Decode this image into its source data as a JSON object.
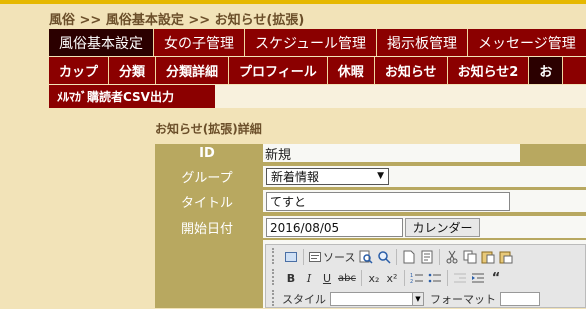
{
  "breadcrumb": "風俗 >> 風俗基本設定 >> お知らせ(拡張)",
  "nav_primary": [
    {
      "label": "風俗基本設定",
      "active": true
    },
    {
      "label": "女の子管理"
    },
    {
      "label": "スケジュール管理"
    },
    {
      "label": "掲示板管理"
    },
    {
      "label": "メッセージ管理"
    }
  ],
  "nav_secondary": [
    {
      "label": "カップ"
    },
    {
      "label": "分類"
    },
    {
      "label": "分類詳細"
    },
    {
      "label": "プロフィール"
    },
    {
      "label": "休暇"
    },
    {
      "label": "お知らせ"
    },
    {
      "label": "お知らせ2"
    },
    {
      "label": "お"
    }
  ],
  "nav_tertiary": {
    "label": "ﾒﾙﾏｶﾞ購読者CSV出力"
  },
  "section_title": "お知らせ(拡張)詳細",
  "form": {
    "id_label": "ID",
    "id_value": "新規",
    "group_label": "グループ",
    "group_value": "新着情報",
    "title_label": "タイトル",
    "title_value": "てすと",
    "date_label": "開始日付",
    "date_value": "2016/08/05",
    "calendar_button": "カレンダー"
  },
  "editor": {
    "source_label": "ソース",
    "style_label": "スタイル",
    "format_label": "フォーマット",
    "bold": "B",
    "italic": "I",
    "underline": "U",
    "strike": "abc",
    "subscript": "x₂",
    "superscript": "x²"
  }
}
